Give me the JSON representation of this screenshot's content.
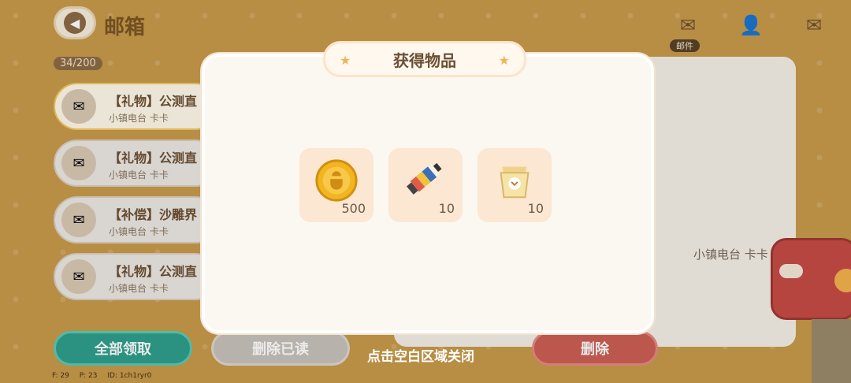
{
  "header": {
    "title": "邮箱"
  },
  "mailbox": {
    "count": "34/200"
  },
  "tabs": {
    "active_label": "邮件"
  },
  "mail_items": [
    {
      "title": "【礼物】公测直",
      "sender": "小镇电台 卡卡"
    },
    {
      "title": "【礼物】公测直",
      "sender": "小镇电台 卡卡"
    },
    {
      "title": "【补偿】沙雕界",
      "sender": "小镇电台 卡卡"
    },
    {
      "title": "【礼物】公测直",
      "sender": "小镇电台 卡卡"
    }
  ],
  "detail_panel": {
    "sender": "小镇电台 卡卡"
  },
  "buttons": {
    "claim_all": "全部领取",
    "delete_read": "删除已读",
    "delete": "删除"
  },
  "modal": {
    "title": "获得物品",
    "items": [
      {
        "icon": "gold-coin-icon",
        "count": "500"
      },
      {
        "icon": "paint-tube-icon",
        "count": "10"
      },
      {
        "icon": "seed-bag-icon",
        "count": "10"
      }
    ],
    "close_hint": "点击空白区域关闭"
  },
  "footer": {
    "f": "F: 29",
    "p": "P: 23",
    "id": "ID: 1ch1ryr0"
  }
}
